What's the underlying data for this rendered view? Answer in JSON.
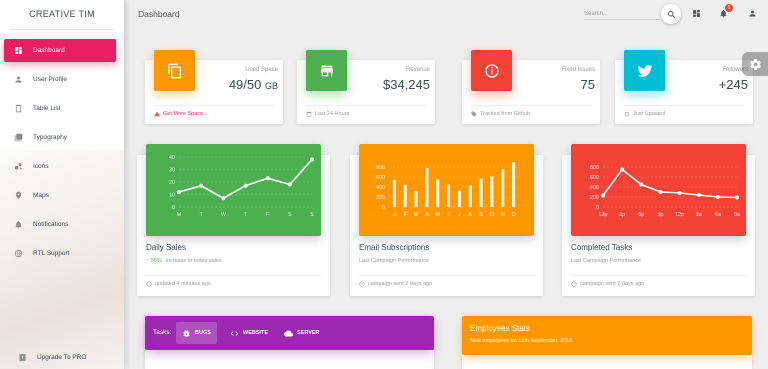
{
  "sidebar": {
    "logo": "CREATIVE TIM",
    "items": [
      {
        "label": "Dashboard",
        "icon": "dashboard-icon",
        "active": true
      },
      {
        "label": "User Profile",
        "icon": "person-icon"
      },
      {
        "label": "Table List",
        "icon": "clipboard-icon"
      },
      {
        "label": "Typography",
        "icon": "library-books-icon"
      },
      {
        "label": "Icons",
        "icon": "bubble-chart-icon"
      },
      {
        "label": "Maps",
        "icon": "location-icon"
      },
      {
        "label": "Notifications",
        "icon": "bell-icon"
      },
      {
        "label": "RTL Support",
        "icon": "language-icon"
      }
    ],
    "upgrade": "Upgrade To PRO"
  },
  "topbar": {
    "title": "Dashboard",
    "search_placeholder": "Search...",
    "notification_count": "5"
  },
  "stats": [
    {
      "category": "Used Space",
      "value": "49/50",
      "unit": "GB",
      "footer": "Get More Space...",
      "color": "#ff9800",
      "icon": "content-copy-icon",
      "footer_icon": "warning-icon"
    },
    {
      "category": "Revenue",
      "value": "$34,245",
      "footer": "Last 24 Hours",
      "color": "#4caf50",
      "icon": "store-icon",
      "footer_icon": "date-range-icon"
    },
    {
      "category": "Fixed Issues",
      "value": "75",
      "footer": "Tracked from Github",
      "color": "#f44336",
      "icon": "info-outline-icon",
      "footer_icon": "local-offer-icon"
    },
    {
      "category": "Followers",
      "value": "+245",
      "footer": "Just Updated",
      "color": "#00bcd4",
      "icon": "twitter-icon",
      "footer_icon": "update-icon"
    }
  ],
  "charts": [
    {
      "title": "Daily Sales",
      "sub_highlight": "55%",
      "sub_text": "increase in today sales.",
      "footer": "updated 4 minutes ago",
      "color": "#4caf50"
    },
    {
      "title": "Email Subscriptions",
      "sub_text": "Last Campaign Performance",
      "footer": "campaign sent 2 days ago",
      "color": "#ff9800"
    },
    {
      "title": "Completed Tasks",
      "sub_text": "Last Campaign Performance",
      "footer": "campaign sent 2 days ago",
      "color": "#f44336"
    }
  ],
  "chart_data": [
    {
      "type": "line",
      "categories": [
        "M",
        "T",
        "W",
        "T",
        "F",
        "S",
        "S"
      ],
      "values": [
        12,
        17,
        7,
        17,
        23,
        18,
        38
      ],
      "yticks": [
        "40",
        "30",
        "20",
        "10",
        "0"
      ],
      "ylim": [
        0,
        40
      ]
    },
    {
      "type": "bar",
      "categories": [
        "J",
        "F",
        "M",
        "A",
        "M",
        "J",
        "J",
        "A",
        "S",
        "O",
        "N",
        "D"
      ],
      "values": [
        542,
        443,
        320,
        780,
        553,
        453,
        326,
        434,
        568,
        610,
        756,
        895
      ],
      "yticks": [
        "800",
        "600",
        "400",
        "200",
        "0"
      ],
      "ylim": [
        0,
        1000
      ]
    },
    {
      "type": "line",
      "categories": [
        "12p",
        "3p",
        "6p",
        "9p",
        "12p",
        "3a",
        "6a",
        "9a"
      ],
      "values": [
        230,
        750,
        450,
        300,
        280,
        240,
        200,
        190
      ],
      "yticks": [
        "800",
        "600",
        "400",
        "200",
        "0"
      ],
      "ylim": [
        0,
        1000
      ]
    }
  ],
  "tasks": {
    "label": "Tasks:",
    "tabs": [
      {
        "label": "BUGS",
        "icon": "bug-icon",
        "active": true
      },
      {
        "label": "WEBSITE",
        "icon": "code-icon"
      },
      {
        "label": "SERVER",
        "icon": "cloud-icon"
      }
    ]
  },
  "employees": {
    "title": "Employees Stats",
    "subtitle": "New employees on 15th September, 2016"
  }
}
